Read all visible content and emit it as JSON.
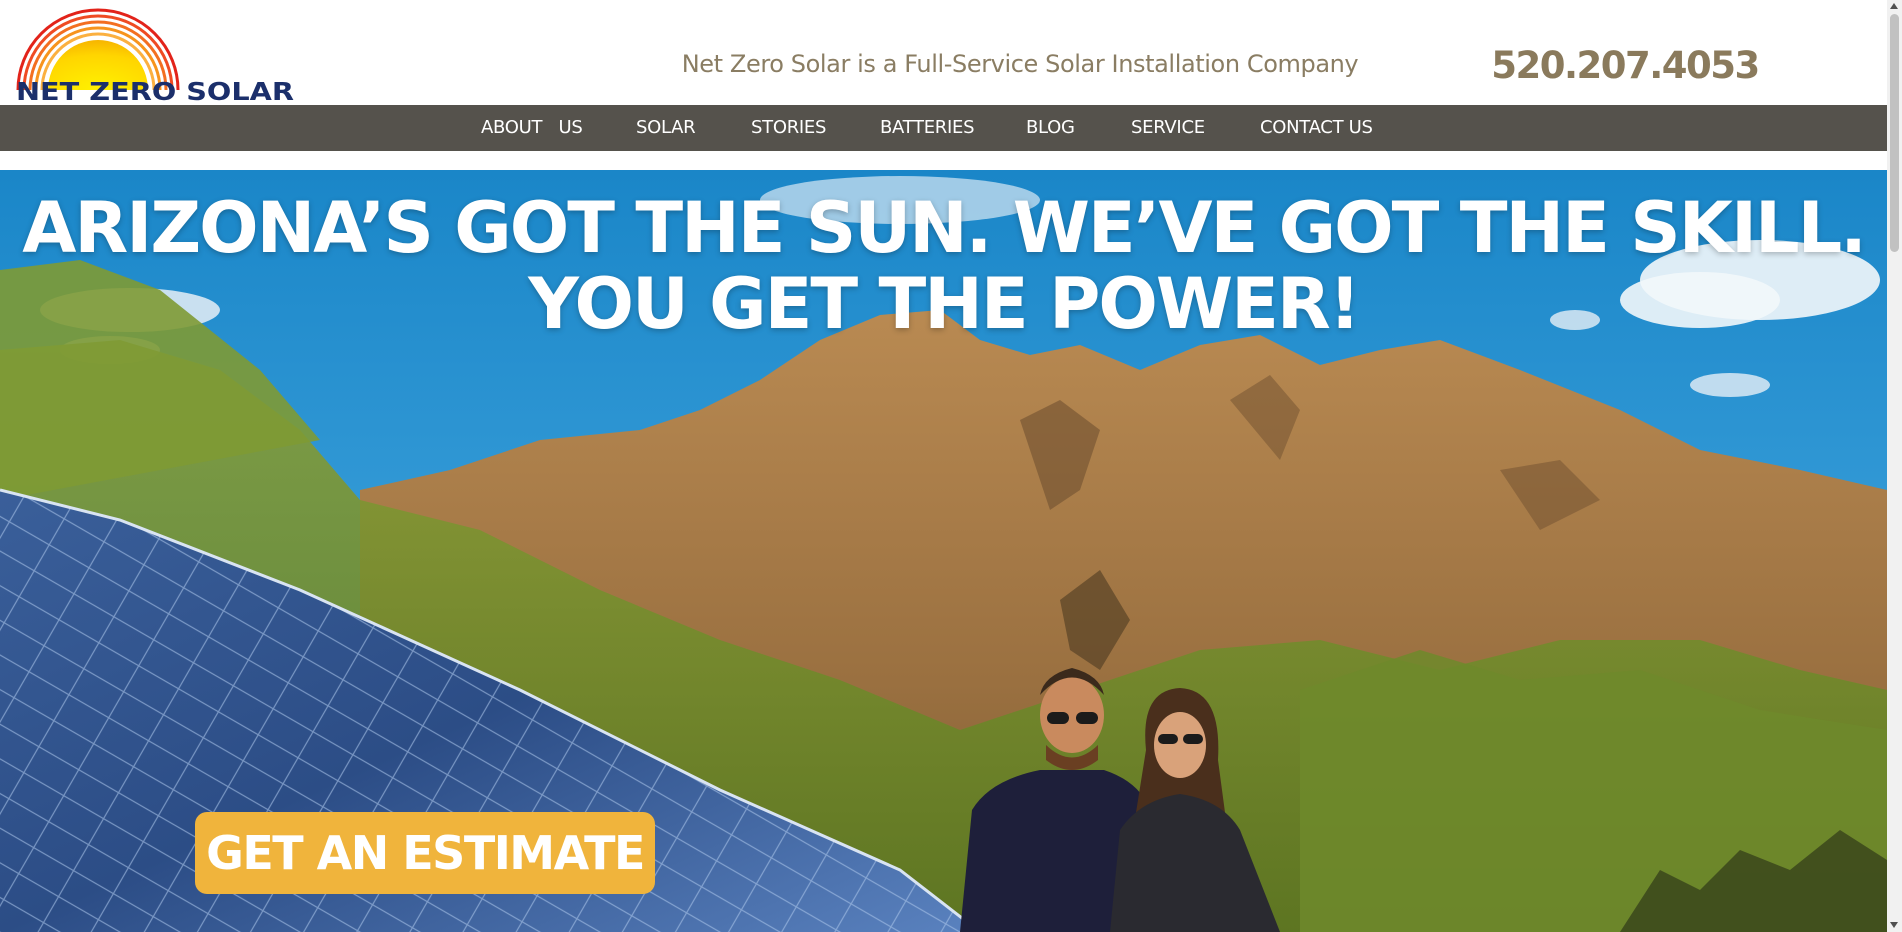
{
  "header": {
    "logo_text": "NET ZERO SOLAR",
    "tagline": "Net Zero Solar is a Full-Service Solar Installation Company",
    "phone": "520.207.4053"
  },
  "nav": {
    "items": [
      {
        "label": "ABOUT   US"
      },
      {
        "label": "SOLAR"
      },
      {
        "label": "STORIES"
      },
      {
        "label": "BATTERIES"
      },
      {
        "label": "BLOG"
      },
      {
        "label": "SERVICE"
      },
      {
        "label": "CONTACT US"
      }
    ]
  },
  "hero": {
    "headline_line1": "ARIZONA’S GOT THE SUN. WE’VE GOT THE SKILL.",
    "headline_line2": "YOU GET THE POWER!",
    "cta_label": "GET AN ESTIMATE"
  },
  "colors": {
    "nav_bg": "#55524c",
    "tagline": "#8a7d63",
    "phone": "#8a7a5c",
    "cta": "#f0b43c",
    "logo_navy": "#1b2f6b",
    "sky": "#1f8fd0"
  }
}
